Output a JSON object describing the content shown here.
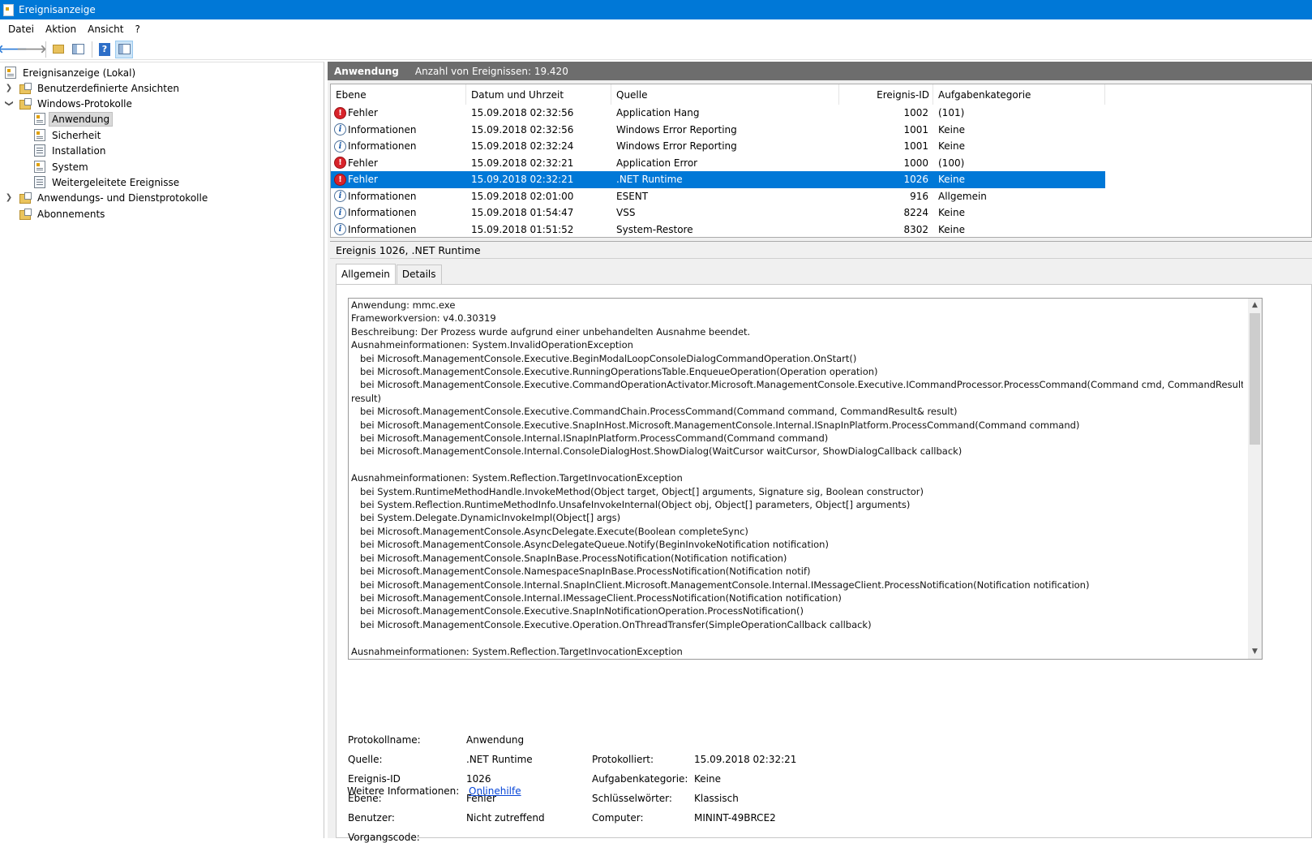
{
  "window": {
    "title": "Ereignisanzeige"
  },
  "menu": {
    "items": [
      "Datei",
      "Aktion",
      "Ansicht",
      "?"
    ]
  },
  "tree": {
    "items": [
      {
        "label": "Ereignisanzeige (Lokal)",
        "level": 0,
        "icon": "event-viewer-icon",
        "expander": ""
      },
      {
        "label": "Benutzerdefinierte Ansichten",
        "level": 1,
        "icon": "folder-icon",
        "expander": "collapsed"
      },
      {
        "label": "Windows-Protokolle",
        "level": 1,
        "icon": "folder-icon",
        "expander": "expanded"
      },
      {
        "label": "Anwendung",
        "level": 2,
        "icon": "event-log-icon",
        "expander": "",
        "selected": true
      },
      {
        "label": "Sicherheit",
        "level": 2,
        "icon": "event-log-icon",
        "expander": ""
      },
      {
        "label": "Installation",
        "level": 2,
        "icon": "log-icon",
        "expander": ""
      },
      {
        "label": "System",
        "level": 2,
        "icon": "event-log-icon",
        "expander": ""
      },
      {
        "label": "Weitergeleitete Ereignisse",
        "level": 2,
        "icon": "log-icon",
        "expander": ""
      },
      {
        "label": "Anwendungs- und Dienstprotokolle",
        "level": 1,
        "icon": "folder-icon",
        "expander": "collapsed"
      },
      {
        "label": "Abonnements",
        "level": 1,
        "icon": "folder-icon",
        "expander": ""
      }
    ]
  },
  "log_header": {
    "name": "Anwendung",
    "count": "Anzahl von Ereignissen: 19.420"
  },
  "grid": {
    "columns": [
      "Ebene",
      "Datum und Uhrzeit",
      "Quelle",
      "Ereignis-ID",
      "Aufgabenkategorie"
    ],
    "rows": [
      {
        "level": "Fehler",
        "type": "error",
        "date": "15.09.2018 02:32:56",
        "source": "Application Hang",
        "id": "1002",
        "category": "(101)"
      },
      {
        "level": "Informationen",
        "type": "info",
        "date": "15.09.2018 02:32:56",
        "source": "Windows Error Reporting",
        "id": "1001",
        "category": "Keine"
      },
      {
        "level": "Informationen",
        "type": "info",
        "date": "15.09.2018 02:32:24",
        "source": "Windows Error Reporting",
        "id": "1001",
        "category": "Keine"
      },
      {
        "level": "Fehler",
        "type": "error",
        "date": "15.09.2018 02:32:21",
        "source": "Application Error",
        "id": "1000",
        "category": "(100)"
      },
      {
        "level": "Fehler",
        "type": "error",
        "date": "15.09.2018 02:32:21",
        "source": ".NET Runtime",
        "id": "1026",
        "category": "Keine",
        "selected": true
      },
      {
        "level": "Informationen",
        "type": "info",
        "date": "15.09.2018 02:01:00",
        "source": "ESENT",
        "id": "916",
        "category": "Allgemein"
      },
      {
        "level": "Informationen",
        "type": "info",
        "date": "15.09.2018 01:54:47",
        "source": "VSS",
        "id": "8224",
        "category": "Keine"
      },
      {
        "level": "Informationen",
        "type": "info",
        "date": "15.09.2018 01:51:52",
        "source": "System-Restore",
        "id": "8302",
        "category": "Keine"
      }
    ]
  },
  "detail": {
    "title": "Ereignis 1026, .NET Runtime",
    "tabs": [
      "Allgemein",
      "Details"
    ],
    "description_lines": [
      "Anwendung: mmc.exe",
      "Frameworkversion: v4.0.30319",
      "Beschreibung: Der Prozess wurde aufgrund einer unbehandelten Ausnahme beendet.",
      "Ausnahmeinformationen: System.InvalidOperationException",
      "   bei Microsoft.ManagementConsole.Executive.BeginModalLoopConsoleDialogCommandOperation.OnStart()",
      "   bei Microsoft.ManagementConsole.Executive.RunningOperationsTable.EnqueueOperation(Operation operation)",
      "   bei Microsoft.ManagementConsole.Executive.CommandOperationActivator.Microsoft.ManagementConsole.Executive.ICommandProcessor.ProcessCommand(Command cmd, CommandResult&",
      "result)",
      "   bei Microsoft.ManagementConsole.Executive.CommandChain.ProcessCommand(Command command, CommandResult& result)",
      "   bei Microsoft.ManagementConsole.Executive.SnapInHost.Microsoft.ManagementConsole.Internal.ISnapInPlatform.ProcessCommand(Command command)",
      "   bei Microsoft.ManagementConsole.Internal.ISnapInPlatform.ProcessCommand(Command command)",
      "   bei Microsoft.ManagementConsole.Internal.ConsoleDialogHost.ShowDialog(WaitCursor waitCursor, ShowDialogCallback callback)",
      "",
      "Ausnahmeinformationen: System.Reflection.TargetInvocationException",
      "   bei System.RuntimeMethodHandle.InvokeMethod(Object target, Object[] arguments, Signature sig, Boolean constructor)",
      "   bei System.Reflection.RuntimeMethodInfo.UnsafeInvokeInternal(Object obj, Object[] parameters, Object[] arguments)",
      "   bei System.Delegate.DynamicInvokeImpl(Object[] args)",
      "   bei Microsoft.ManagementConsole.AsyncDelegate.Execute(Boolean completeSync)",
      "   bei Microsoft.ManagementConsole.AsyncDelegateQueue.Notify(BeginInvokeNotification notification)",
      "   bei Microsoft.ManagementConsole.SnapInBase.ProcessNotification(Notification notification)",
      "   bei Microsoft.ManagementConsole.NamespaceSnapInBase.ProcessNotification(Notification notif)",
      "   bei Microsoft.ManagementConsole.Internal.SnapInClient.Microsoft.ManagementConsole.Internal.IMessageClient.ProcessNotification(Notification notification)",
      "   bei Microsoft.ManagementConsole.Internal.IMessageClient.ProcessNotification(Notification notification)",
      "   bei Microsoft.ManagementConsole.Executive.SnapInNotificationOperation.ProcessNotification()",
      "   bei Microsoft.ManagementConsole.Executive.Operation.OnThreadTransfer(SimpleOperationCallback callback)",
      "",
      "Ausnahmeinformationen: System.Reflection.TargetInvocationException"
    ],
    "props": {
      "protokollname_label": "Protokollname:",
      "protokollname": "Anwendung",
      "quelle_label": "Quelle:",
      "quelle": ".NET Runtime",
      "protokolliert_label": "Protokolliert:",
      "protokolliert": "15.09.2018 02:32:21",
      "ereignisid_label": "Ereignis-ID",
      "ereignisid": "1026",
      "aufgabenkategorie_label": "Aufgabenkategorie:",
      "aufgabenkategorie": "Keine",
      "ebene_label": "Ebene:",
      "ebene": "Fehler",
      "schluessel_label": "Schlüsselwörter:",
      "schluessel": "Klassisch",
      "benutzer_label": "Benutzer:",
      "benutzer": "Nicht zutreffend",
      "computer_label": "Computer:",
      "computer": "MININT-49BRCE2",
      "vorgangscode_label": "Vorgangscode:",
      "weitere_label": "Weitere Informationen:",
      "weitere_link": "Onlinehilfe"
    }
  },
  "colors": {
    "titlebar": "#0078d7",
    "selection": "#0078d7",
    "header": "#6d6d6d",
    "error": "#d8232a"
  }
}
